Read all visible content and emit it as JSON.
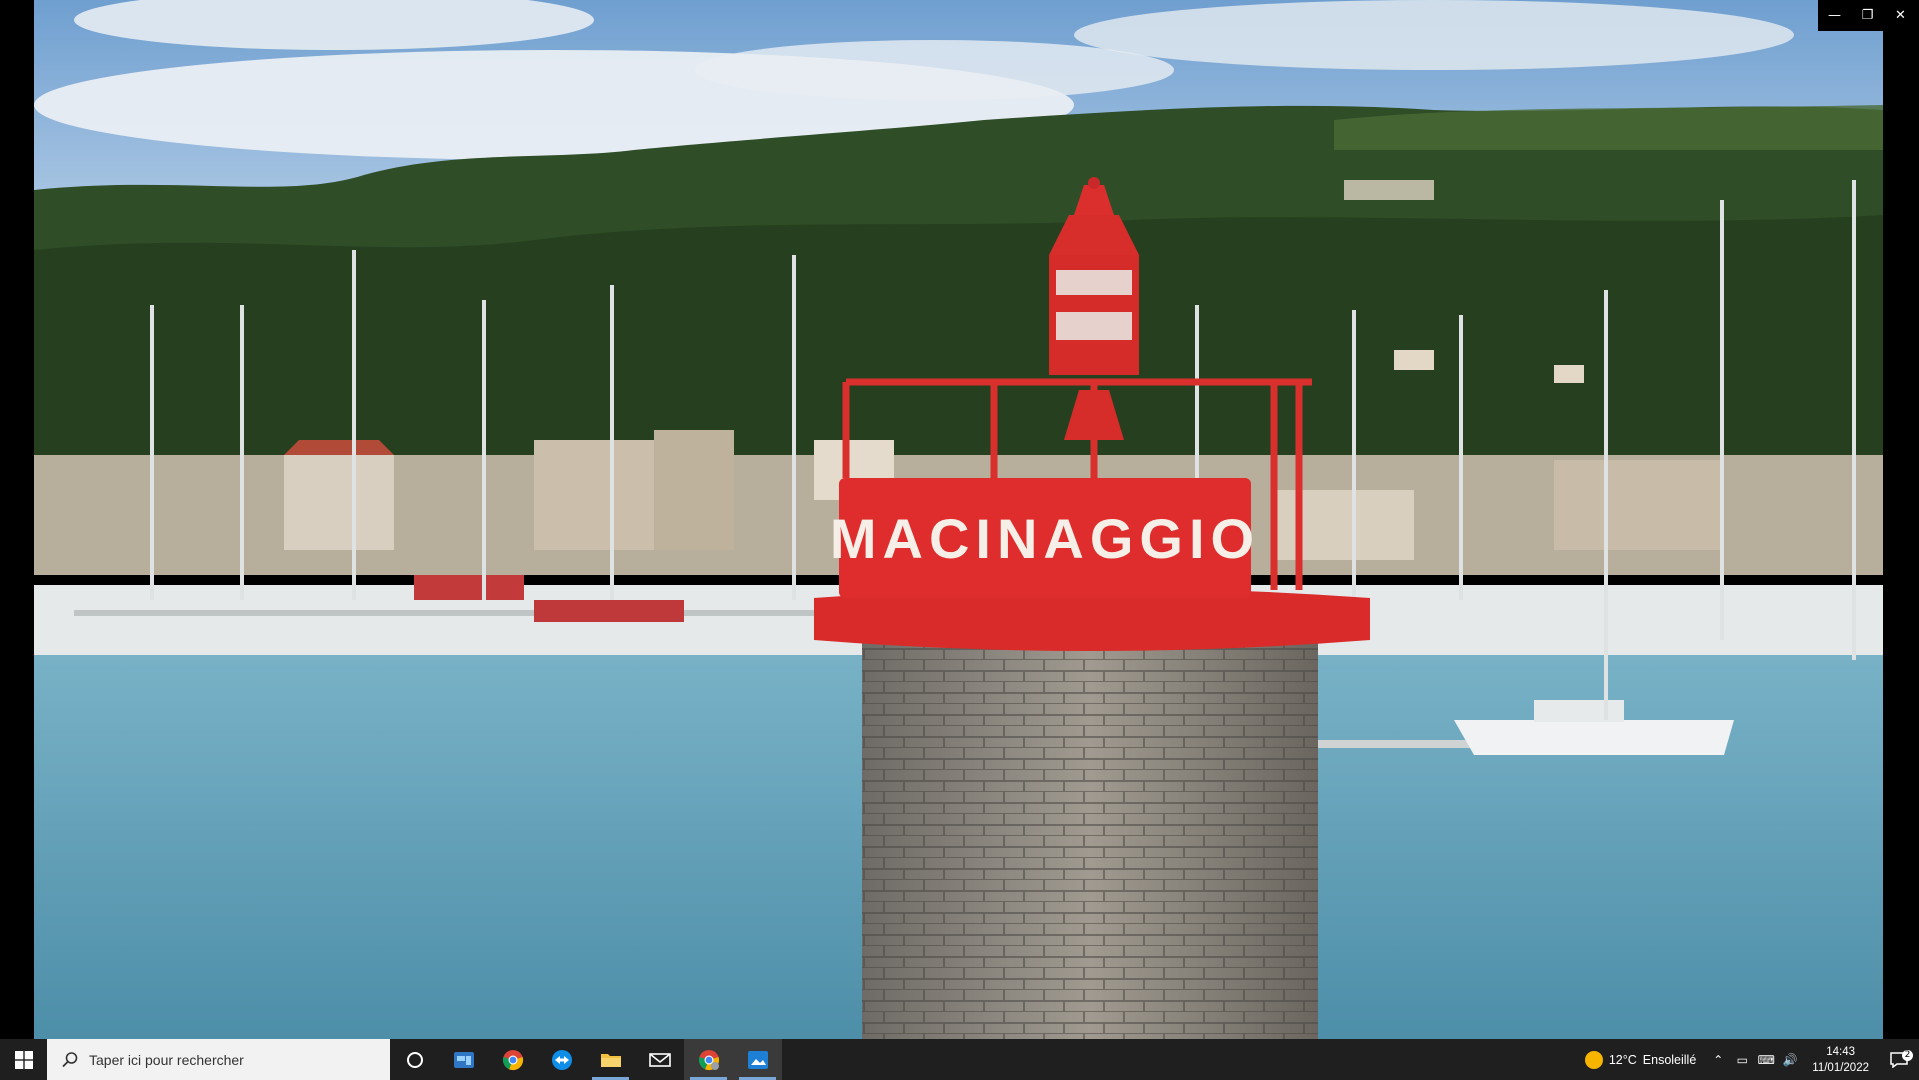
{
  "photo": {
    "sign_text": "MACINAGGIO"
  },
  "window": {
    "minimize_glyph": "—",
    "restore_glyph": "❐",
    "close_glyph": "✕"
  },
  "taskbar": {
    "search_placeholder": "Taper ici pour rechercher",
    "icons": [
      "windows-logo",
      "cortana",
      "photos-tile",
      "chrome",
      "teamviewer",
      "file-explorer",
      "mail",
      "chrome-profile",
      "photos-viewer"
    ],
    "weather": {
      "temp": "12°C",
      "condition": "Ensoleillé"
    },
    "tray_symbols": {
      "chevron": "⌃",
      "network": "▭",
      "keyboard": "⌨",
      "volume": "🔊"
    },
    "clock": {
      "time": "14:43",
      "date": "11/01/2022"
    },
    "notifications": "2"
  }
}
